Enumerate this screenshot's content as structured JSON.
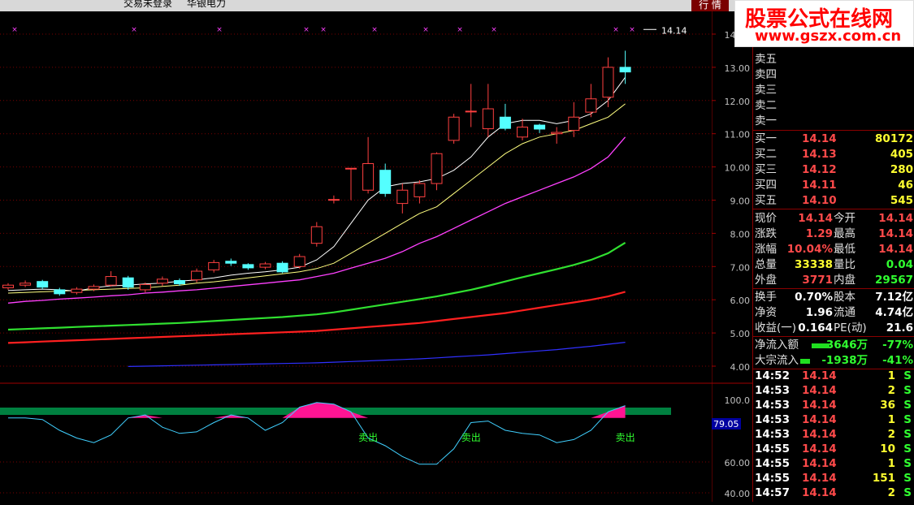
{
  "window": {
    "title_login": "交易未登录",
    "title_stock": "华银电力",
    "tab_label": "行 情"
  },
  "watermark": {
    "line1": "股票公式在线网",
    "line2": "www.gszx.com.cn"
  },
  "price_axis": {
    "ticks": [
      "14.00",
      "13.00",
      "12.00",
      "11.00",
      "10.00",
      "9.00",
      "8.00",
      "7.00",
      "6.00",
      "5.00",
      "4.00"
    ],
    "current_price_tag": "14.14"
  },
  "indicator_axis": {
    "ticks": [
      "100.0",
      "60.00",
      "40.00"
    ],
    "current_value_tag": "79.05",
    "sell_signals": [
      "卖出",
      "卖出",
      "卖出"
    ]
  },
  "colors": {
    "up": "#ff4040",
    "down": "#54ffff",
    "ma5": "#ffffff",
    "ma10": "#ffff80",
    "ma20": "#ff40ff",
    "ma60": "#30e030",
    "ma120": "#ff2020",
    "ma250": "#3030ff",
    "indicator_line": "#40d0ff",
    "indicator_fill": "#ff1493",
    "indicator_band": "#008040"
  },
  "chart_data": {
    "type": "candlestick",
    "ylim": [
      4.0,
      14.5
    ],
    "candles": [
      {
        "o": 6.36,
        "c": 6.44,
        "h": 6.5,
        "l": 6.3
      },
      {
        "o": 6.44,
        "c": 6.5,
        "h": 6.58,
        "l": 6.38
      },
      {
        "o": 6.55,
        "c": 6.38,
        "h": 6.6,
        "l": 6.32
      },
      {
        "o": 6.3,
        "c": 6.18,
        "h": 6.36,
        "l": 6.12
      },
      {
        "o": 6.22,
        "c": 6.32,
        "h": 6.38,
        "l": 6.16
      },
      {
        "o": 6.32,
        "c": 6.4,
        "h": 6.46,
        "l": 6.26
      },
      {
        "o": 6.44,
        "c": 6.7,
        "h": 6.86,
        "l": 6.4
      },
      {
        "o": 6.66,
        "c": 6.38,
        "h": 6.72,
        "l": 6.3
      },
      {
        "o": 6.3,
        "c": 6.46,
        "h": 6.52,
        "l": 6.22
      },
      {
        "o": 6.5,
        "c": 6.62,
        "h": 6.7,
        "l": 6.42
      },
      {
        "o": 6.58,
        "c": 6.48,
        "h": 6.64,
        "l": 6.42
      },
      {
        "o": 6.6,
        "c": 6.86,
        "h": 6.94,
        "l": 6.52
      },
      {
        "o": 6.9,
        "c": 7.12,
        "h": 7.2,
        "l": 6.82
      },
      {
        "o": 7.16,
        "c": 7.1,
        "h": 7.24,
        "l": 7.02
      },
      {
        "o": 7.06,
        "c": 6.96,
        "h": 7.1,
        "l": 6.9
      },
      {
        "o": 6.98,
        "c": 7.08,
        "h": 7.14,
        "l": 6.92
      },
      {
        "o": 7.1,
        "c": 6.84,
        "h": 7.16,
        "l": 6.8
      },
      {
        "o": 7.0,
        "c": 7.3,
        "h": 7.38,
        "l": 6.94
      },
      {
        "o": 7.7,
        "c": 8.2,
        "h": 8.34,
        "l": 7.6
      },
      {
        "o": 9.02,
        "c": 9.02,
        "h": 9.14,
        "l": 8.9
      },
      {
        "o": 9.96,
        "c": 9.96,
        "h": 9.96,
        "l": 9.0
      },
      {
        "o": 9.3,
        "c": 10.1,
        "h": 10.9,
        "l": 9.2
      },
      {
        "o": 9.9,
        "c": 9.2,
        "h": 10.1,
        "l": 9.1
      },
      {
        "o": 8.9,
        "c": 9.3,
        "h": 9.5,
        "l": 8.6
      },
      {
        "o": 9.1,
        "c": 9.5,
        "h": 9.6,
        "l": 8.9
      },
      {
        "o": 9.5,
        "c": 10.4,
        "h": 10.44,
        "l": 9.3
      },
      {
        "o": 10.8,
        "c": 11.5,
        "h": 11.6,
        "l": 10.7
      },
      {
        "o": 11.68,
        "c": 11.68,
        "h": 12.5,
        "l": 11.2
      },
      {
        "o": 11.15,
        "c": 11.75,
        "h": 12.5,
        "l": 10.9
      },
      {
        "o": 11.5,
        "c": 11.16,
        "h": 11.9,
        "l": 11.1
      },
      {
        "o": 10.9,
        "c": 11.2,
        "h": 11.45,
        "l": 10.8
      },
      {
        "o": 11.26,
        "c": 11.14,
        "h": 11.3,
        "l": 11.02
      },
      {
        "o": 11.0,
        "c": 11.04,
        "h": 11.2,
        "l": 10.7
      },
      {
        "o": 11.1,
        "c": 11.5,
        "h": 11.95,
        "l": 10.9
      },
      {
        "o": 11.65,
        "c": 12.05,
        "h": 12.5,
        "l": 11.5
      },
      {
        "o": 12.1,
        "c": 13.0,
        "h": 13.3,
        "l": 11.8
      },
      {
        "o": 13.0,
        "c": 12.86,
        "h": 13.5,
        "l": 12.5
      }
    ],
    "ma5": [
      6.28,
      6.3,
      6.32,
      6.3,
      6.26,
      6.36,
      6.42,
      6.44,
      6.48,
      6.5,
      6.56,
      6.6,
      6.66,
      6.74,
      6.8,
      6.84,
      6.9,
      6.98,
      7.2,
      7.6,
      8.3,
      9.0,
      9.4,
      9.5,
      9.55,
      9.65,
      9.9,
      10.3,
      10.9,
      11.3,
      11.4,
      11.4,
      11.3,
      11.4,
      11.6,
      12.0,
      12.7
    ],
    "ma10": [
      6.2,
      6.22,
      6.24,
      6.26,
      6.28,
      6.3,
      6.32,
      6.34,
      6.36,
      6.4,
      6.44,
      6.5,
      6.54,
      6.6,
      6.66,
      6.72,
      6.78,
      6.84,
      6.94,
      7.1,
      7.4,
      7.7,
      8.0,
      8.3,
      8.6,
      8.8,
      9.2,
      9.6,
      10.0,
      10.4,
      10.7,
      10.9,
      11.0,
      11.1,
      11.3,
      11.5,
      11.9
    ],
    "ma20": [
      5.9,
      5.95,
      5.98,
      6.02,
      6.05,
      6.08,
      6.12,
      6.15,
      6.2,
      6.23,
      6.27,
      6.3,
      6.35,
      6.4,
      6.45,
      6.5,
      6.55,
      6.6,
      6.7,
      6.8,
      6.95,
      7.1,
      7.25,
      7.45,
      7.7,
      7.9,
      8.15,
      8.4,
      8.65,
      8.9,
      9.1,
      9.3,
      9.5,
      9.7,
      9.95,
      10.3,
      10.9
    ],
    "ma60": [
      5.1,
      5.12,
      5.14,
      5.16,
      5.18,
      5.2,
      5.22,
      5.24,
      5.26,
      5.28,
      5.3,
      5.33,
      5.36,
      5.39,
      5.42,
      5.45,
      5.48,
      5.52,
      5.56,
      5.62,
      5.7,
      5.78,
      5.86,
      5.94,
      6.02,
      6.1,
      6.2,
      6.3,
      6.42,
      6.55,
      6.68,
      6.8,
      6.92,
      7.05,
      7.2,
      7.4,
      7.72
    ],
    "ma120": [
      4.7,
      4.72,
      4.74,
      4.76,
      4.78,
      4.8,
      4.82,
      4.84,
      4.86,
      4.88,
      4.9,
      4.92,
      4.94,
      4.96,
      4.98,
      5.0,
      5.02,
      5.04,
      5.06,
      5.1,
      5.14,
      5.18,
      5.22,
      5.26,
      5.3,
      5.36,
      5.42,
      5.48,
      5.54,
      5.6,
      5.68,
      5.76,
      5.84,
      5.92,
      6.0,
      6.1,
      6.24
    ],
    "ma250": [
      null,
      null,
      null,
      null,
      null,
      null,
      null,
      3.99,
      4.0,
      4.01,
      4.02,
      4.03,
      4.04,
      4.05,
      4.06,
      4.07,
      4.08,
      4.09,
      4.1,
      4.12,
      4.14,
      4.16,
      4.18,
      4.2,
      4.22,
      4.25,
      4.28,
      4.31,
      4.34,
      4.38,
      4.42,
      4.46,
      4.5,
      4.55,
      4.6,
      4.66,
      4.72
    ],
    "indicator": [
      88,
      88,
      87,
      80,
      75,
      72,
      77,
      88,
      90,
      82,
      78,
      79,
      85,
      90,
      88,
      80,
      85,
      95,
      98,
      97,
      92,
      75,
      70,
      63,
      58,
      58,
      68,
      85,
      86,
      80,
      78,
      77,
      72,
      74,
      80,
      92,
      96
    ],
    "indicator_ylim": [
      40,
      110
    ],
    "sell_signal_bars": [
      22,
      28,
      37
    ]
  },
  "quote": {
    "sell_levels": [
      {
        "label": "卖五",
        "price": "",
        "vol": ""
      },
      {
        "label": "卖四",
        "price": "",
        "vol": ""
      },
      {
        "label": "卖三",
        "price": "",
        "vol": ""
      },
      {
        "label": "卖二",
        "price": "",
        "vol": ""
      },
      {
        "label": "卖一",
        "price": "",
        "vol": ""
      }
    ],
    "buy_levels": [
      {
        "label": "买一",
        "price": "14.14",
        "vol": "80172"
      },
      {
        "label": "买二",
        "price": "14.13",
        "vol": "405"
      },
      {
        "label": "买三",
        "price": "14.12",
        "vol": "280"
      },
      {
        "label": "买四",
        "price": "14.11",
        "vol": "46"
      },
      {
        "label": "买五",
        "price": "14.10",
        "vol": "545"
      }
    ],
    "stats": [
      {
        "l1": "现价",
        "v1": "14.14",
        "c1": "red",
        "l2": "今开",
        "v2": "14.14",
        "c2": "red"
      },
      {
        "l1": "涨跌",
        "v1": "1.29",
        "c1": "red",
        "l2": "最高",
        "v2": "14.14",
        "c2": "red"
      },
      {
        "l1": "涨幅",
        "v1": "10.04%",
        "c1": "red",
        "l2": "最低",
        "v2": "14.14",
        "c2": "red"
      },
      {
        "l1": "总量",
        "v1": "33338",
        "c1": "yel",
        "l2": "量比",
        "v2": "0.04",
        "c2": "grn"
      },
      {
        "l1": "外盘",
        "v1": "3771",
        "c1": "red",
        "l2": "内盘",
        "v2": "29567",
        "c2": "grn"
      }
    ],
    "finance": [
      {
        "l1": "换手",
        "v1": "0.70%",
        "l2": "股本",
        "v2": "7.12亿"
      },
      {
        "l1": "净资",
        "v1": "1.96",
        "l2": "流通",
        "v2": "4.74亿"
      },
      {
        "l1": "收益(一)",
        "v1": "0.164",
        "l2": "PE(动)",
        "v2": "21.6"
      }
    ],
    "flows": [
      {
        "label": "净流入额",
        "value": "-3646万",
        "pct": "-77%"
      },
      {
        "label": "大宗流入",
        "value": "-1938万",
        "pct": "-41%"
      }
    ],
    "ticks": [
      {
        "time": "14:52",
        "price": "14.14",
        "vol": "1",
        "side": "S"
      },
      {
        "time": "14:53",
        "price": "14.14",
        "vol": "2",
        "side": "S"
      },
      {
        "time": "14:53",
        "price": "14.14",
        "vol": "36",
        "side": "S"
      },
      {
        "time": "14:53",
        "price": "14.14",
        "vol": "1",
        "side": "S"
      },
      {
        "time": "14:53",
        "price": "14.14",
        "vol": "2",
        "side": "S"
      },
      {
        "time": "14:55",
        "price": "14.14",
        "vol": "10",
        "side": "S"
      },
      {
        "time": "14:55",
        "price": "14.14",
        "vol": "1",
        "side": "S"
      },
      {
        "time": "14:55",
        "price": "14.14",
        "vol": "151",
        "side": "S"
      },
      {
        "time": "14:57",
        "price": "14.14",
        "vol": "2",
        "side": "S"
      }
    ]
  }
}
